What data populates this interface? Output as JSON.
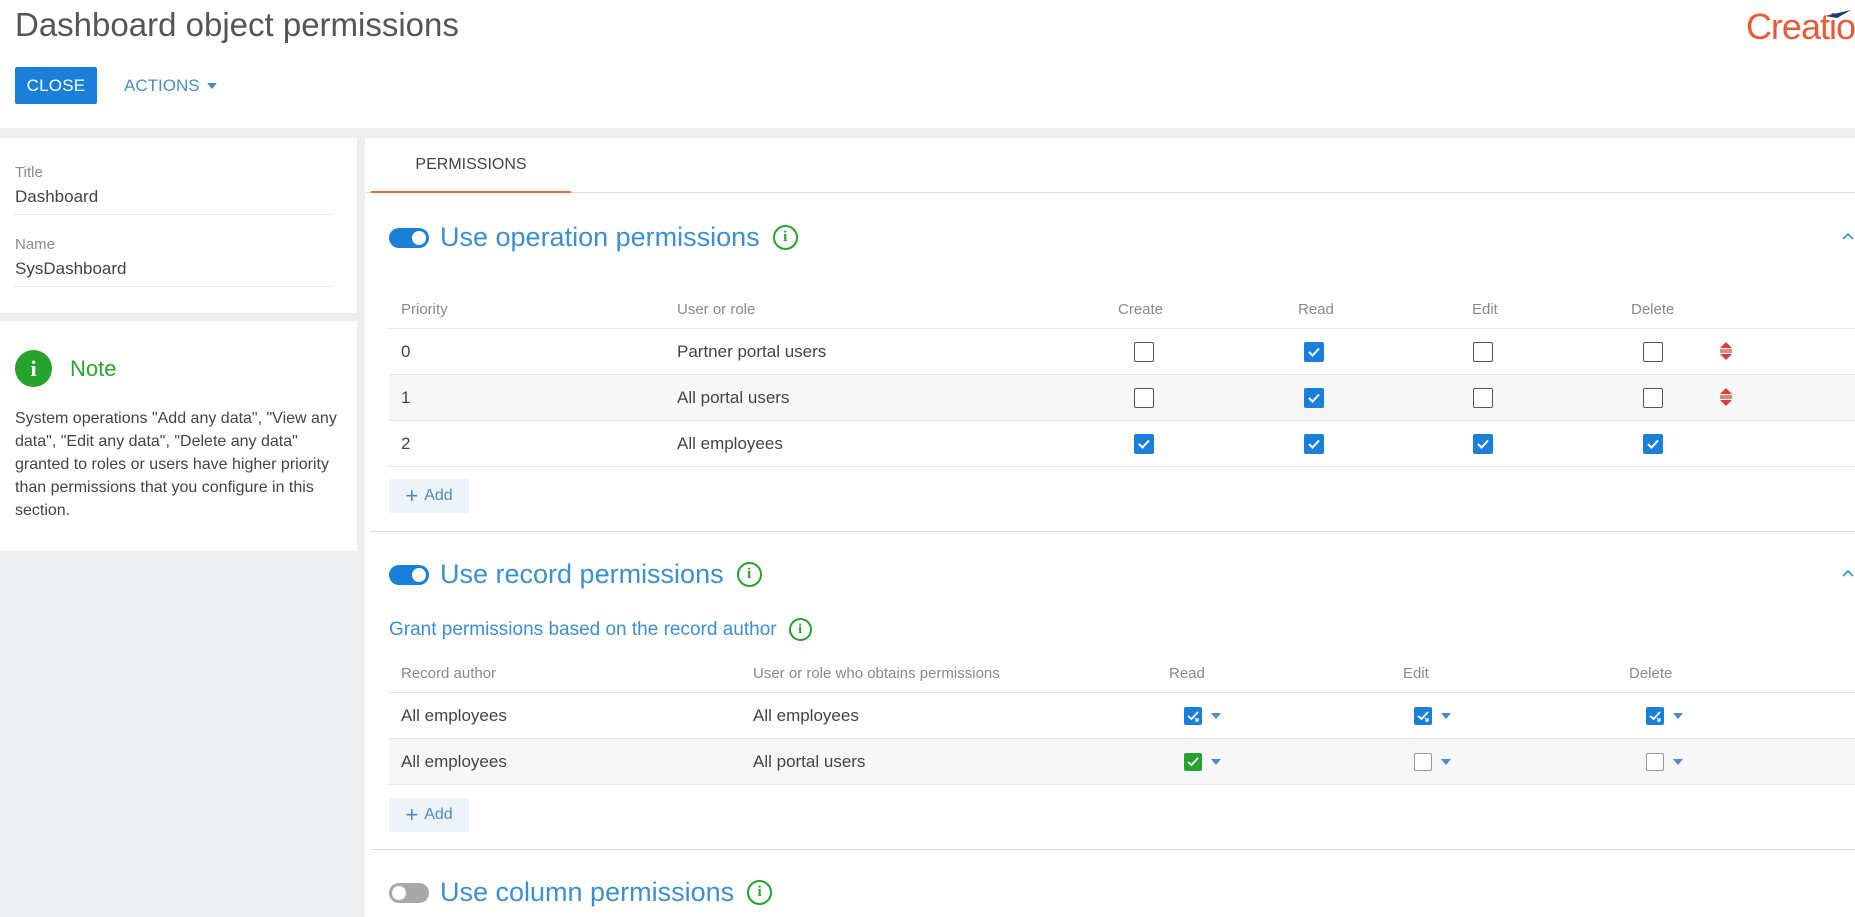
{
  "header": {
    "title": "Dashboard object permissions",
    "close_label": "CLOSE",
    "actions_label": "ACTIONS",
    "logo_text": "Creatio"
  },
  "info_card": {
    "title_label": "Title",
    "title_value": "Dashboard",
    "name_label": "Name",
    "name_value": "SysDashboard"
  },
  "note": {
    "title": "Note",
    "text": "System operations \"Add any data\", \"View any data\", \"Edit any data\", \"Delete any data\" granted to roles or users have higher priority than permissions that you configure in this section."
  },
  "tabs": [
    {
      "label": "PERMISSIONS",
      "active": true
    }
  ],
  "operation_permissions": {
    "title": "Use operation permissions",
    "enabled": true,
    "columns": [
      "Priority",
      "User or role",
      "Create",
      "Read",
      "Edit",
      "Delete"
    ],
    "rows": [
      {
        "priority": "0",
        "role": "Partner portal users",
        "create": false,
        "read": true,
        "edit": false,
        "delete": false
      },
      {
        "priority": "1",
        "role": "All portal users",
        "create": false,
        "read": true,
        "edit": false,
        "delete": false
      },
      {
        "priority": "2",
        "role": "All employees",
        "create": true,
        "read": true,
        "edit": true,
        "delete": true
      }
    ],
    "add_label": "Add"
  },
  "record_permissions": {
    "title": "Use record permissions",
    "enabled": true,
    "subtitle": "Grant permissions based on the record author",
    "columns": [
      "Record author",
      "User or role who obtains permissions",
      "Read",
      "Edit",
      "Delete"
    ],
    "rows": [
      {
        "author": "All employees",
        "grantee": "All employees",
        "read": "granted-with-delegation",
        "edit": "granted-with-delegation",
        "delete": "granted-with-delegation"
      },
      {
        "author": "All employees",
        "grantee": "All portal users",
        "read": "granted",
        "edit": "none",
        "delete": "none"
      }
    ],
    "add_label": "Add"
  },
  "column_permissions": {
    "title": "Use column permissions",
    "enabled": false
  },
  "colors": {
    "accent": "#1a7fd8",
    "link": "#3c8fd0",
    "success": "#27a22c",
    "tab_underline": "#e2703d",
    "logo": "#e85a3a"
  }
}
